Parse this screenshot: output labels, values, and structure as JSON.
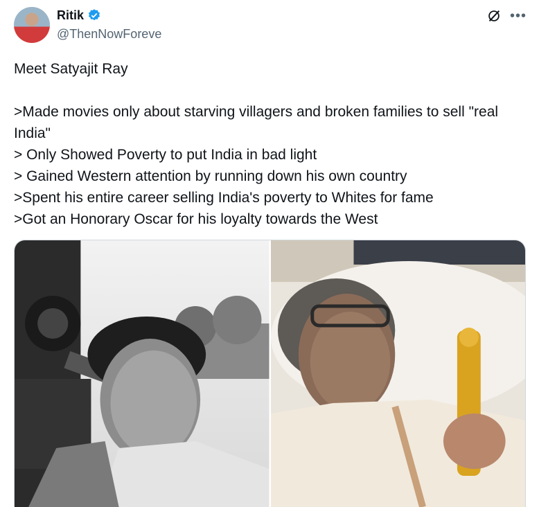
{
  "user": {
    "name": "Ritik",
    "handle": "@ThenNowForeve"
  },
  "tweet": {
    "lines": [
      "Meet Satyajit Ray",
      "",
      ">Made movies only about starving villagers and broken families to sell \"real India\"",
      "> Only Showed Poverty to put India in bad light",
      "> Gained Western attention by running down his own country",
      ">Spent his entire career selling India's poverty to Whites for fame",
      ">Got an Honorary Oscar for his loyalty towards the West"
    ]
  },
  "media": {
    "photos": [
      {
        "subject": "bw-camera-portrait"
      },
      {
        "subject": "hospital-bed-oscar"
      }
    ]
  },
  "colors": {
    "verified": "#1d9bf0",
    "secondary_text": "#536471",
    "border": "#cfd9de"
  },
  "icons": [
    "verified-badge-icon",
    "grok-icon",
    "more-options-icon"
  ]
}
